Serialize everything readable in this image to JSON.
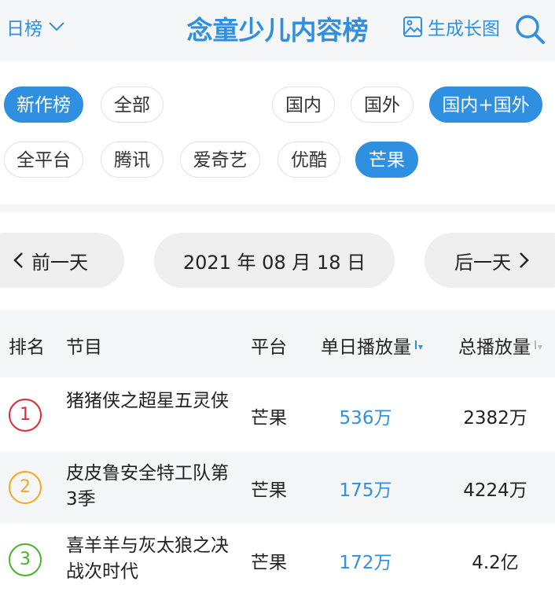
{
  "header": {
    "period_label": "日榜",
    "title": "念童少儿内容榜",
    "generate_label": "生成长图"
  },
  "filters": {
    "row1": [
      "新作榜",
      "全部",
      "国内",
      "国外",
      "国内+国外"
    ],
    "row2": [
      "全平台",
      "腾讯",
      "爱奇艺",
      "优酷",
      "芒果"
    ]
  },
  "date_nav": {
    "prev": "前一天",
    "date": "2021 年 08 月 18 日",
    "next": "后一天"
  },
  "table": {
    "headers": {
      "rank": "排名",
      "program": "节目",
      "platform": "平台",
      "daily": "单日播放量",
      "total": "总播放量"
    },
    "rows": [
      {
        "rank": "1",
        "program": "猪猪侠之超星五灵侠",
        "platform": "芒果",
        "daily": "536万",
        "total": "2382万"
      },
      {
        "rank": "2",
        "program": "皮皮鲁安全特工队第3季",
        "platform": "芒果",
        "daily": "175万",
        "total": "4224万"
      },
      {
        "rank": "3",
        "program": "喜羊羊与灰太狼之决战次时代",
        "platform": "芒果",
        "daily": "172万",
        "total": "4.2亿"
      }
    ]
  },
  "colors": {
    "accent": "#2f8fe0",
    "rank1": "#e0283a",
    "rank2": "#f5a623",
    "rank3": "#4caf2e"
  }
}
